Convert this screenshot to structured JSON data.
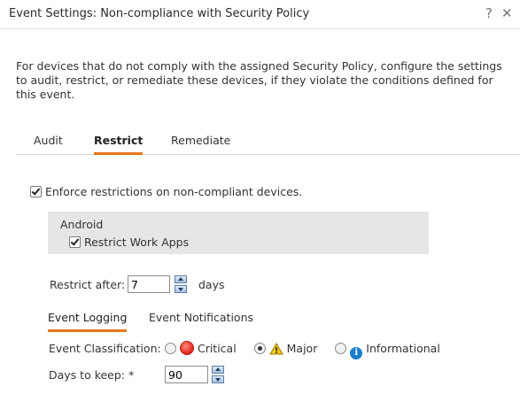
{
  "dialog": {
    "title": "Event Settings: Non-compliance with Security Policy",
    "help_glyph": "?",
    "close_glyph": "✕"
  },
  "intro_text": "For devices that do not comply with the assigned Security Policy, configure the settings to audit, restrict, or remediate these devices, if they violate the conditions defined for this event.",
  "tabs": [
    {
      "label": "Audit",
      "active": false
    },
    {
      "label": "Restrict",
      "active": true
    },
    {
      "label": "Remediate",
      "active": false
    }
  ],
  "enforce": {
    "label": "Enforce restrictions on non-compliant devices.",
    "checked": true
  },
  "android": {
    "heading": "Android",
    "restrict_work_apps": {
      "label": "Restrict Work Apps",
      "checked": true
    }
  },
  "restrict_after": {
    "label": "Restrict after:",
    "value": "7",
    "unit": "days"
  },
  "subtabs": [
    {
      "label": "Event Logging",
      "active": true
    },
    {
      "label": "Event Notifications",
      "active": false
    }
  ],
  "classification": {
    "label": "Event Classification:",
    "options": [
      {
        "label": "Critical",
        "icon": "critical-icon",
        "selected": false
      },
      {
        "label": "Major",
        "icon": "warning-icon",
        "selected": true
      },
      {
        "label": "Informational",
        "icon": "info-icon",
        "selected": false
      }
    ]
  },
  "days_to_keep": {
    "label": "Days to keep: *",
    "value": "90"
  },
  "colors": {
    "accent": "#e8751a",
    "panel_bg": "#e6e6e6"
  }
}
